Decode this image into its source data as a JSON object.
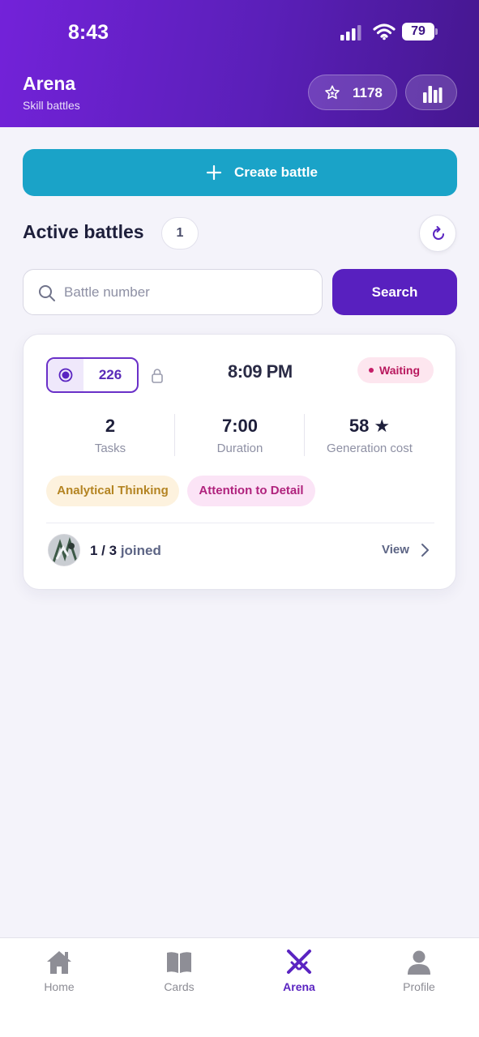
{
  "status_bar": {
    "time": "8:43",
    "battery": "79"
  },
  "header": {
    "title": "Arena",
    "subtitle": "Skill battles",
    "stars": "1178"
  },
  "create_button": {
    "label": "Create battle"
  },
  "active_battles": {
    "title": "Active battles",
    "count": "1"
  },
  "search": {
    "placeholder": "Battle number",
    "value": "",
    "button_label": "Search"
  },
  "battle_card": {
    "number": "226",
    "time": "8:09 PM",
    "status": "Waiting",
    "stats": [
      {
        "value": "2",
        "label": "Tasks"
      },
      {
        "value": "7:00",
        "label": "Duration"
      },
      {
        "value": "58 ★",
        "label": "Generation cost"
      }
    ],
    "tags": [
      "Analytical Thinking",
      "Attention to Detail"
    ],
    "joined_count": "1 / 3",
    "joined_label": "joined",
    "view_label": "View"
  },
  "tabbar": {
    "items": [
      {
        "label": "Home",
        "icon": "home-icon"
      },
      {
        "label": "Cards",
        "icon": "book-icon"
      },
      {
        "label": "Arena",
        "icon": "crossed-swords-icon",
        "active": true
      },
      {
        "label": "Profile",
        "icon": "person-icon"
      }
    ]
  },
  "colors": {
    "header_start": "#7322d9",
    "header_end": "#45178f",
    "create": "#1aa3c8",
    "accent": "#5820bf",
    "waiting": "#b8195e"
  }
}
